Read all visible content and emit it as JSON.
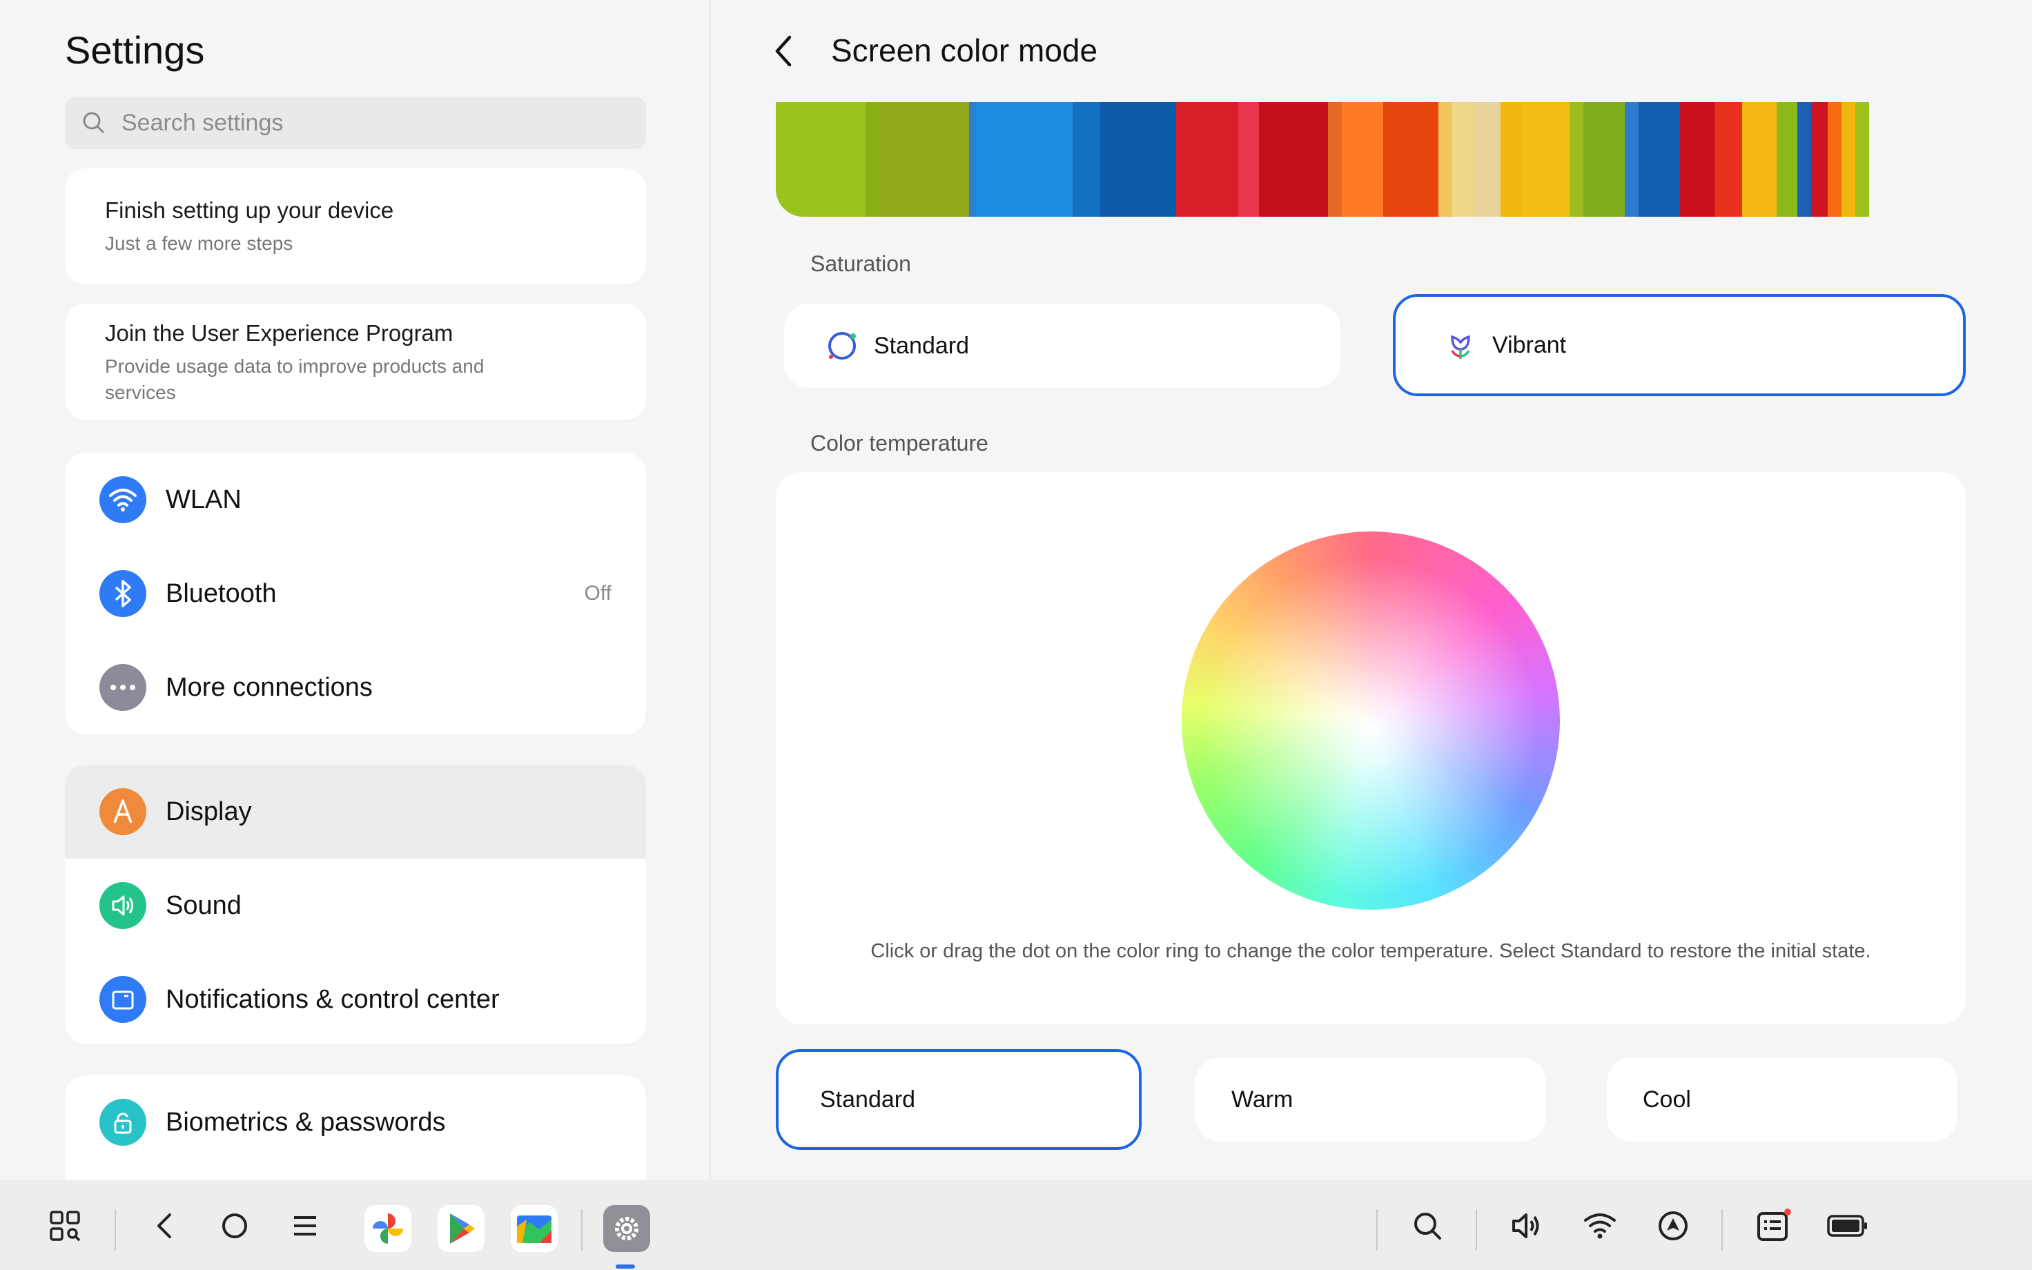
{
  "left": {
    "title": "Settings",
    "search_placeholder": "Search settings",
    "tips": [
      {
        "title": "Finish setting up your device",
        "subtitle": "Just a few more steps"
      },
      {
        "title": "Join the User Experience Program",
        "subtitle": "Provide usage data to improve products and services"
      }
    ],
    "group1": [
      {
        "label": "WLAN",
        "icon": "wifi-icon",
        "color": "#2f7bf5",
        "value": ""
      },
      {
        "label": "Bluetooth",
        "icon": "bluetooth-icon",
        "color": "#2f7bf5",
        "value": "Off"
      },
      {
        "label": "More connections",
        "icon": "more-icon",
        "color": "#8b8b99",
        "value": ""
      }
    ],
    "group2": [
      {
        "label": "Display",
        "icon": "display-icon",
        "color": "#f08a3a",
        "selected": true
      },
      {
        "label": "Sound",
        "icon": "sound-icon",
        "color": "#22c48a"
      },
      {
        "label": "Notifications & control center",
        "icon": "notifications-icon",
        "color": "#2f7bf5"
      }
    ],
    "group3": [
      {
        "label": "Biometrics & passwords",
        "icon": "lock-icon",
        "color": "#27c3c9"
      }
    ]
  },
  "right": {
    "title": "Screen color mode",
    "saturation_label": "Saturation",
    "saturation_options": [
      {
        "label": "Standard",
        "selected": false
      },
      {
        "label": "Vibrant",
        "selected": true
      }
    ],
    "temperature_label": "Color temperature",
    "hint": "Click or drag the dot on the color ring to change the color temperature. Select Standard to restore the initial state.",
    "temperature_options": [
      {
        "label": "Standard",
        "selected": true
      },
      {
        "label": "Warm",
        "selected": false
      },
      {
        "label": "Cool",
        "selected": false
      }
    ],
    "accent": "#1c66e0"
  },
  "taskbar": {
    "left_icons": [
      "apps-grid-icon",
      "back-icon",
      "home-icon",
      "recents-icon"
    ],
    "apps": [
      "photos-app-icon",
      "play-store-icon",
      "files-app-icon",
      "settings-app-icon"
    ],
    "right_icons": [
      "search-icon",
      "volume-icon",
      "wifi-icon",
      "navigation-icon",
      "notes-icon",
      "battery-icon"
    ]
  }
}
